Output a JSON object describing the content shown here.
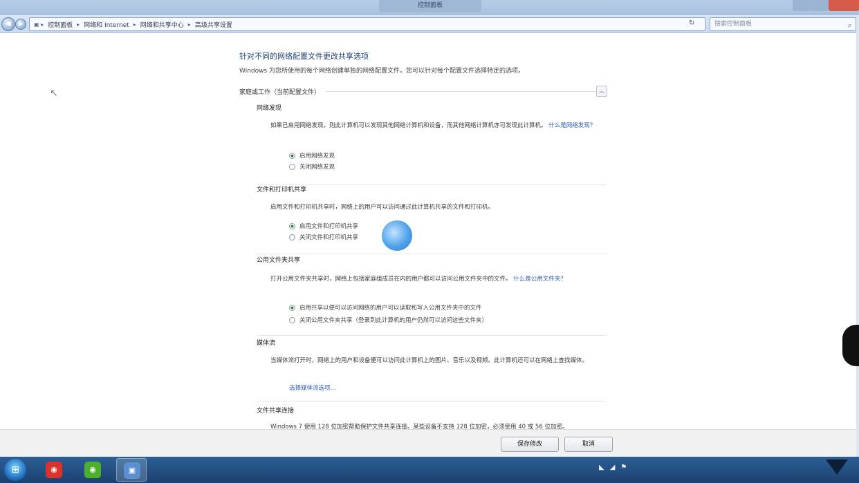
{
  "window": {
    "title": "控制面板"
  },
  "address_bar": {
    "back_icon": "back-arrow-icon",
    "forward_icon": "forward-arrow-icon",
    "breadcrumbs": [
      "控制面板",
      "网络和 Internet",
      "网络和共享中心",
      "高级共享设置"
    ],
    "search_placeholder": "搜索控制面板"
  },
  "content": {
    "heading": "针对不同的网络配置文件更改共享选项",
    "description": "Windows 为您所使用的每个网络创建单独的网络配置文件。您可以针对每个配置文件选择特定的选项。",
    "profile_header": "家庭或工作（当前配置文件）",
    "sections": [
      {
        "title": "网络发现",
        "body": "如果已启用网络发现，则此计算机可以发现其他网络计算机和设备，而其他网络计算机亦可发现此计算机。",
        "link": "什么是网络发现？",
        "options": [
          {
            "label": "启用网络发现",
            "selected": true
          },
          {
            "label": "关闭网络发现",
            "selected": false
          }
        ]
      },
      {
        "title": "文件和打印机共享",
        "body": "启用文件和打印机共享时，网络上的用户可以访问通过此计算机共享的文件和打印机。",
        "options": [
          {
            "label": "启用文件和打印机共享",
            "selected": true
          },
          {
            "label": "关闭文件和打印机共享",
            "selected": false
          }
        ]
      },
      {
        "title": "公用文件夹共享",
        "body": "打开公用文件夹共享时，网络上包括家庭组成员在内的用户都可以访问公用文件夹中的文件。",
        "link": "什么是公用文件夹？",
        "options": [
          {
            "label": "启用共享以便可以访问网络的用户可以读取和写入公用文件夹中的文件",
            "selected": true
          },
          {
            "label": "关闭公用文件夹共享（登录到此计算机的用户仍然可以访问这些文件夹）",
            "selected": false
          }
        ]
      },
      {
        "title": "媒体流",
        "body": "当媒体流打开时，网络上的用户和设备便可以访问此计算机上的图片、音乐以及视频。此计算机还可以在网络上查找媒体。",
        "link": "选择媒体流选项..."
      },
      {
        "title": "文件共享连接",
        "body": "Windows 7 使用 128 位加密帮助保护文件共享连接。某些设备不支持 128 位加密，必须使用 40 或 56 位加密。"
      }
    ]
  },
  "buttons": {
    "save": "保存修改",
    "cancel": "取消"
  },
  "taskbar": {
    "start_icon": "windows-start-icon",
    "apps": [
      {
        "name": "app-red-icon",
        "color": "#d9342b",
        "glyph": "◉"
      },
      {
        "name": "app-green-icon",
        "color": "#4caf2e",
        "glyph": "◉"
      },
      {
        "name": "control-panel-icon",
        "color": "#5b8fd0",
        "glyph": "▣"
      }
    ],
    "tray_icons": [
      "network-icon",
      "volume-icon",
      "flag-icon"
    ]
  },
  "colors": {
    "accent": "#1e3f75",
    "link": "#2a5db0",
    "taskbar": "#1c4170"
  }
}
